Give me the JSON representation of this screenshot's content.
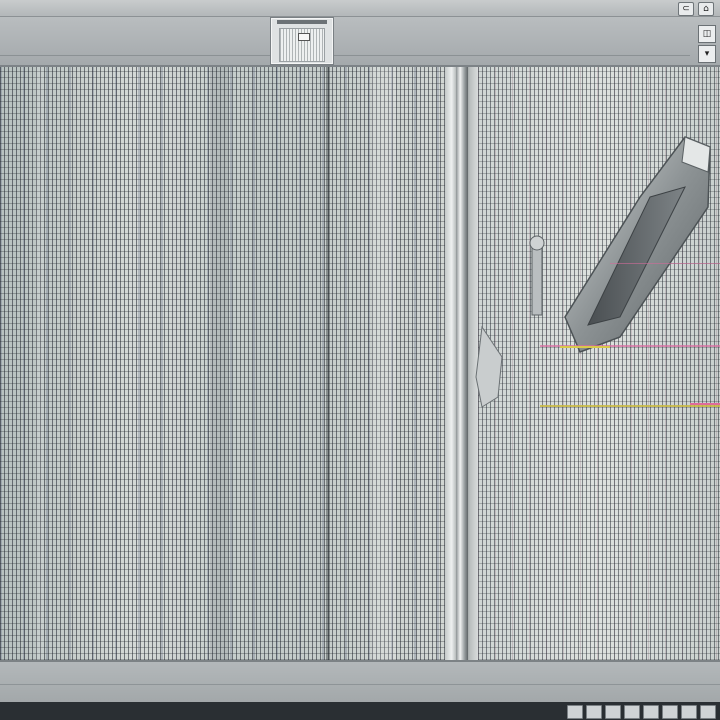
{
  "window": {
    "title": ""
  },
  "toolbar": {
    "thumbnail_caption": "",
    "side_tools": [
      {
        "icon": "camera-icon",
        "glyph": "◫"
      },
      {
        "icon": "dropdown-arrow-icon",
        "glyph": "▾"
      }
    ]
  },
  "title_controls": [
    {
      "icon": "lock-icon",
      "glyph": "⊂"
    },
    {
      "icon": "minimize-icon",
      "glyph": "⌂"
    }
  ],
  "canvas": {
    "accent_colors": {
      "pink_line": "#d86aa0",
      "yellow_line": "#d9c84a"
    }
  },
  "taskbar": {
    "tray_icons": [
      "tray-icon-1",
      "tray-icon-2",
      "tray-icon-3",
      "tray-icon-4",
      "tray-icon-5",
      "tray-icon-6",
      "tray-icon-7",
      "tray-icon-8"
    ]
  }
}
